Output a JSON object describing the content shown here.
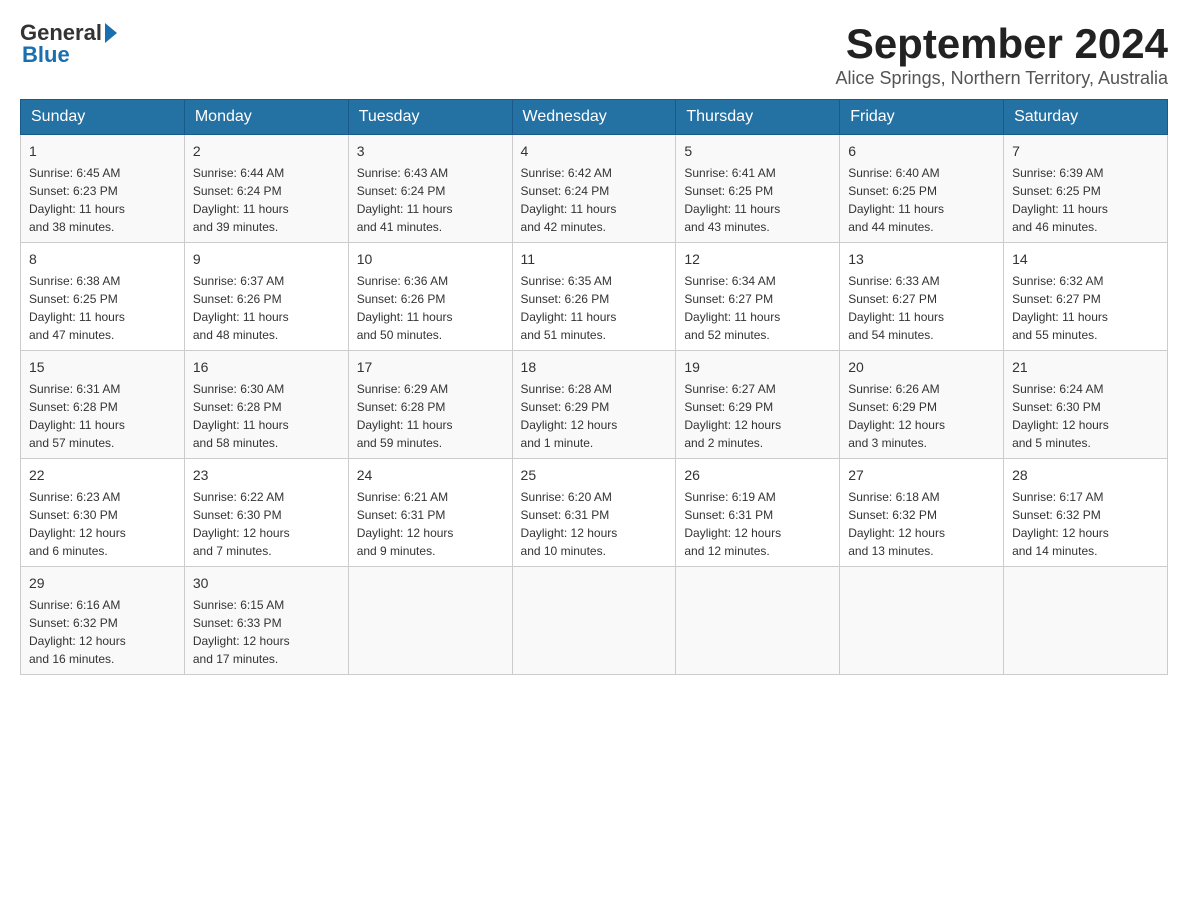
{
  "header": {
    "logo_general": "General",
    "logo_blue": "Blue",
    "month_year": "September 2024",
    "location": "Alice Springs, Northern Territory, Australia"
  },
  "days_of_week": [
    "Sunday",
    "Monday",
    "Tuesday",
    "Wednesday",
    "Thursday",
    "Friday",
    "Saturday"
  ],
  "weeks": [
    [
      {
        "day": "1",
        "sunrise": "6:45 AM",
        "sunset": "6:23 PM",
        "daylight": "11 hours and 38 minutes."
      },
      {
        "day": "2",
        "sunrise": "6:44 AM",
        "sunset": "6:24 PM",
        "daylight": "11 hours and 39 minutes."
      },
      {
        "day": "3",
        "sunrise": "6:43 AM",
        "sunset": "6:24 PM",
        "daylight": "11 hours and 41 minutes."
      },
      {
        "day": "4",
        "sunrise": "6:42 AM",
        "sunset": "6:24 PM",
        "daylight": "11 hours and 42 minutes."
      },
      {
        "day": "5",
        "sunrise": "6:41 AM",
        "sunset": "6:25 PM",
        "daylight": "11 hours and 43 minutes."
      },
      {
        "day": "6",
        "sunrise": "6:40 AM",
        "sunset": "6:25 PM",
        "daylight": "11 hours and 44 minutes."
      },
      {
        "day": "7",
        "sunrise": "6:39 AM",
        "sunset": "6:25 PM",
        "daylight": "11 hours and 46 minutes."
      }
    ],
    [
      {
        "day": "8",
        "sunrise": "6:38 AM",
        "sunset": "6:25 PM",
        "daylight": "11 hours and 47 minutes."
      },
      {
        "day": "9",
        "sunrise": "6:37 AM",
        "sunset": "6:26 PM",
        "daylight": "11 hours and 48 minutes."
      },
      {
        "day": "10",
        "sunrise": "6:36 AM",
        "sunset": "6:26 PM",
        "daylight": "11 hours and 50 minutes."
      },
      {
        "day": "11",
        "sunrise": "6:35 AM",
        "sunset": "6:26 PM",
        "daylight": "11 hours and 51 minutes."
      },
      {
        "day": "12",
        "sunrise": "6:34 AM",
        "sunset": "6:27 PM",
        "daylight": "11 hours and 52 minutes."
      },
      {
        "day": "13",
        "sunrise": "6:33 AM",
        "sunset": "6:27 PM",
        "daylight": "11 hours and 54 minutes."
      },
      {
        "day": "14",
        "sunrise": "6:32 AM",
        "sunset": "6:27 PM",
        "daylight": "11 hours and 55 minutes."
      }
    ],
    [
      {
        "day": "15",
        "sunrise": "6:31 AM",
        "sunset": "6:28 PM",
        "daylight": "11 hours and 57 minutes."
      },
      {
        "day": "16",
        "sunrise": "6:30 AM",
        "sunset": "6:28 PM",
        "daylight": "11 hours and 58 minutes."
      },
      {
        "day": "17",
        "sunrise": "6:29 AM",
        "sunset": "6:28 PM",
        "daylight": "11 hours and 59 minutes."
      },
      {
        "day": "18",
        "sunrise": "6:28 AM",
        "sunset": "6:29 PM",
        "daylight": "12 hours and 1 minute."
      },
      {
        "day": "19",
        "sunrise": "6:27 AM",
        "sunset": "6:29 PM",
        "daylight": "12 hours and 2 minutes."
      },
      {
        "day": "20",
        "sunrise": "6:26 AM",
        "sunset": "6:29 PM",
        "daylight": "12 hours and 3 minutes."
      },
      {
        "day": "21",
        "sunrise": "6:24 AM",
        "sunset": "6:30 PM",
        "daylight": "12 hours and 5 minutes."
      }
    ],
    [
      {
        "day": "22",
        "sunrise": "6:23 AM",
        "sunset": "6:30 PM",
        "daylight": "12 hours and 6 minutes."
      },
      {
        "day": "23",
        "sunrise": "6:22 AM",
        "sunset": "6:30 PM",
        "daylight": "12 hours and 7 minutes."
      },
      {
        "day": "24",
        "sunrise": "6:21 AM",
        "sunset": "6:31 PM",
        "daylight": "12 hours and 9 minutes."
      },
      {
        "day": "25",
        "sunrise": "6:20 AM",
        "sunset": "6:31 PM",
        "daylight": "12 hours and 10 minutes."
      },
      {
        "day": "26",
        "sunrise": "6:19 AM",
        "sunset": "6:31 PM",
        "daylight": "12 hours and 12 minutes."
      },
      {
        "day": "27",
        "sunrise": "6:18 AM",
        "sunset": "6:32 PM",
        "daylight": "12 hours and 13 minutes."
      },
      {
        "day": "28",
        "sunrise": "6:17 AM",
        "sunset": "6:32 PM",
        "daylight": "12 hours and 14 minutes."
      }
    ],
    [
      {
        "day": "29",
        "sunrise": "6:16 AM",
        "sunset": "6:32 PM",
        "daylight": "12 hours and 16 minutes."
      },
      {
        "day": "30",
        "sunrise": "6:15 AM",
        "sunset": "6:33 PM",
        "daylight": "12 hours and 17 minutes."
      },
      null,
      null,
      null,
      null,
      null
    ]
  ],
  "labels": {
    "sunrise": "Sunrise:",
    "sunset": "Sunset:",
    "daylight": "Daylight:"
  }
}
